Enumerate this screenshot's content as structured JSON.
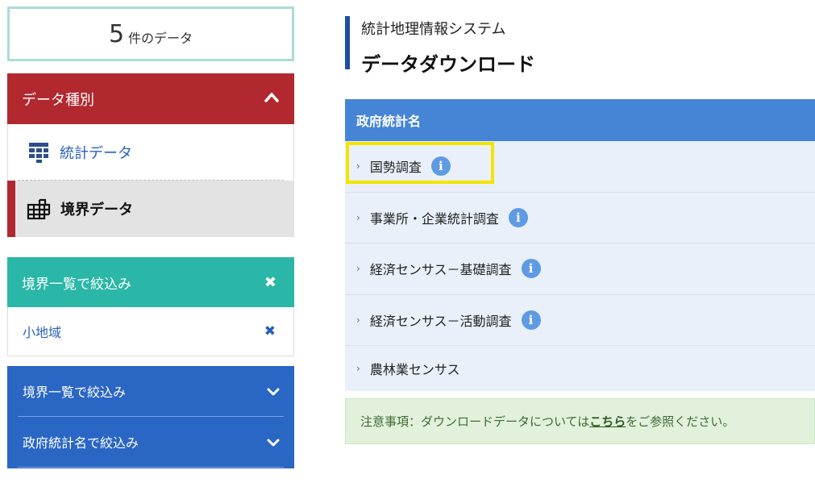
{
  "result": {
    "count": "5",
    "unit": "件のデータ"
  },
  "data_type": {
    "header": "データ種別",
    "items": [
      {
        "label": "統計データ",
        "icon": "table-icon"
      },
      {
        "label": "境界データ",
        "icon": "grid-icon"
      }
    ]
  },
  "filter_selected": {
    "header": "境界一覧で絞込み",
    "item": "小地域"
  },
  "filters": [
    {
      "label": "境界一覧で絞込み"
    },
    {
      "label": "政府統計名で絞込み"
    }
  ],
  "page": {
    "subtitle": "統計地理情報システム",
    "title": "データダウンロード"
  },
  "stat_list": {
    "header": "政府統計名",
    "rows": [
      {
        "name": "国勢調査",
        "info": true
      },
      {
        "name": "事業所・企業統計調査",
        "info": true
      },
      {
        "name": "経済センサス－基礎調査",
        "info": true
      },
      {
        "name": "経済センサス－活動調査",
        "info": true
      },
      {
        "name": "農林業センサス",
        "info": false
      }
    ]
  },
  "notice": {
    "prefix": "注意事項：ダウンロードデータについては",
    "link": "こちら",
    "suffix": "をご参照ください。"
  },
  "colors": {
    "accent_red": "#b2282f",
    "teal": "#2ab7a7",
    "blue": "#2a66c4",
    "table_header": "#4685d6",
    "highlight": "#f5e400"
  }
}
